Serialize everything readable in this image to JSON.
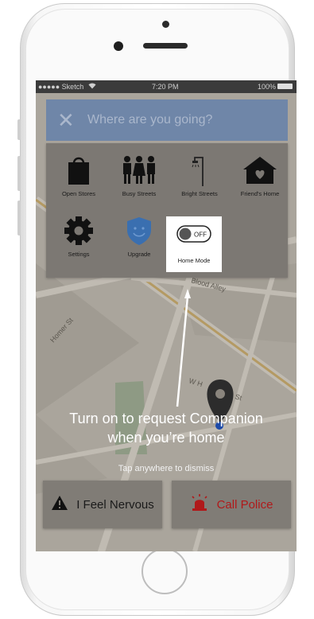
{
  "status_bar": {
    "carrier": "●●●●● Sketch",
    "time": "7:20 PM",
    "battery": "100%"
  },
  "search": {
    "placeholder": "Where are you going?",
    "close_icon": "close-icon"
  },
  "menu": {
    "items": [
      {
        "label": "Open Stores",
        "icon": "shopping-bag-icon"
      },
      {
        "label": "Busy Streets",
        "icon": "people-icon"
      },
      {
        "label": "Bright Streets",
        "icon": "streetlight-icon"
      },
      {
        "label": "Friend's Home",
        "icon": "house-heart-icon"
      },
      {
        "label": "Settings",
        "icon": "gear-icon"
      },
      {
        "label": "Upgrade",
        "icon": "shield-icon"
      },
      {
        "label": "Home Mode",
        "icon": "toggle-icon",
        "toggle_state": "OFF"
      }
    ]
  },
  "map": {
    "streets": [
      "Blood Alley",
      "Homer St",
      "W H",
      "St"
    ]
  },
  "tooltip": {
    "title_line1": "Turn on to request Companion",
    "title_line2": "when you’re home",
    "dismiss_hint": "Tap anywhere to dismiss"
  },
  "actions": {
    "nervous_label": "I Feel Nervous",
    "police_label": "Call Police"
  },
  "colors": {
    "search_bar": "#6f86a8",
    "police_red": "#b0191a",
    "upgrade_blue": "#3a7bd5"
  }
}
